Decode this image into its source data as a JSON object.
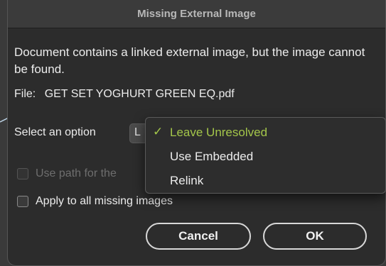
{
  "dialog": {
    "title": "Missing External Image",
    "message": "Document contains a linked external image, but the image cannot be found.",
    "file_label": "File:",
    "file_name": "GET SET YOGHURT GREEN EQ.pdf",
    "option_label": "Select an option",
    "select_stub_text": "L",
    "use_path_label": "Use path for the",
    "apply_all_label": "Apply to all missing images",
    "cancel_label": "Cancel",
    "ok_label": "OK"
  },
  "menu": {
    "items": [
      {
        "label": "Leave Unresolved",
        "selected": true
      },
      {
        "label": "Use Embedded",
        "selected": false
      },
      {
        "label": "Relink",
        "selected": false
      }
    ],
    "check_glyph": "✓"
  },
  "colors": {
    "accent_selected": "#a4c64a"
  }
}
